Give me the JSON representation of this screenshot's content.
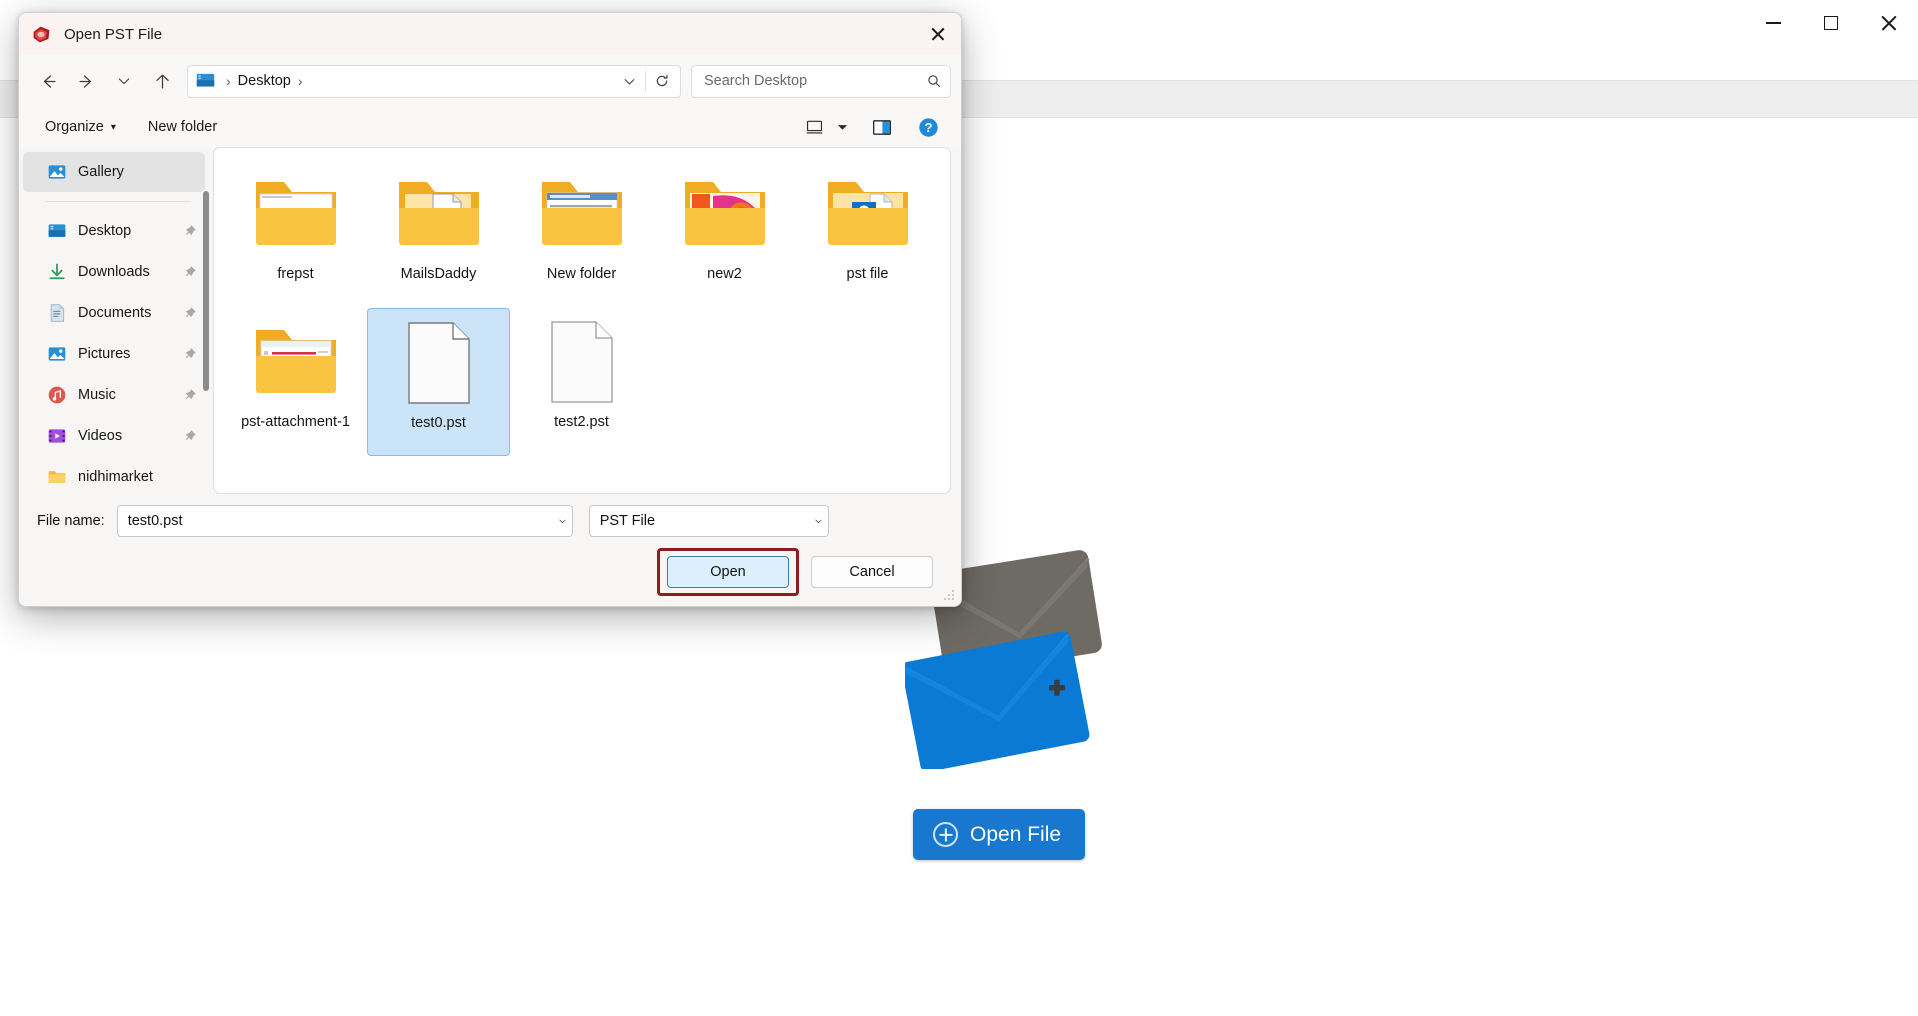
{
  "background_app": {
    "window_controls": [
      {
        "name": "minimize",
        "glyph": "minimize-icon"
      },
      {
        "name": "maximize",
        "glyph": "maximize-icon"
      },
      {
        "name": "close",
        "glyph": "close-icon"
      }
    ],
    "open_file_button": "Open File",
    "open_file_icon": "plus-circle-icon",
    "envelope_gray_color": "#6e6a64",
    "envelope_blue_color": "#0b7ad4",
    "accent_color": "#1878d0"
  },
  "dialog": {
    "title": "Open PST File",
    "app_icon": "pst-file-icon",
    "close_icon": "close-icon",
    "nav": {
      "back_icon": "arrow-left-icon",
      "forward_icon": "arrow-right-icon",
      "recent_icon": "chevron-down-icon",
      "up_icon": "arrow-up-icon",
      "breadcrumb_icon": "desktop-icon",
      "breadcrumb": [
        "Desktop"
      ],
      "breadcrumb_separator": "›",
      "address_dropdown_icon": "chevron-down-icon",
      "refresh_icon": "refresh-icon"
    },
    "search": {
      "placeholder": "Search Desktop",
      "value": "",
      "icon": "search-icon"
    },
    "command_bar": {
      "organize": "Organize",
      "organize_caret": "▾",
      "new_folder": "New folder",
      "view_icon": "view-layout-icon",
      "view_caret": "▾",
      "preview_pane_icon": "preview-pane-icon",
      "help_icon": "help-icon"
    },
    "sidebar": {
      "items": [
        {
          "label": "Gallery",
          "icon": "gallery-icon",
          "pinned": false,
          "selected": true
        },
        {
          "label": "Desktop",
          "icon": "desktop-icon",
          "pinned": true,
          "selected": false
        },
        {
          "label": "Downloads",
          "icon": "downloads-icon",
          "pinned": true,
          "selected": false
        },
        {
          "label": "Documents",
          "icon": "documents-icon",
          "pinned": true,
          "selected": false
        },
        {
          "label": "Pictures",
          "icon": "pictures-icon",
          "pinned": true,
          "selected": false
        },
        {
          "label": "Music",
          "icon": "music-icon",
          "pinned": true,
          "selected": false
        },
        {
          "label": "Videos",
          "icon": "videos-icon",
          "pinned": true,
          "selected": false
        },
        {
          "label": "nidhimarket",
          "icon": "folder-icon",
          "pinned": false,
          "selected": false
        }
      ]
    },
    "files": [
      {
        "name": "frepst",
        "type": "folder",
        "thumb": "document-preview",
        "selected": false
      },
      {
        "name": "MailsDaddy",
        "type": "folder",
        "thumb": "page-preview",
        "selected": false
      },
      {
        "name": "New folder",
        "type": "folder",
        "thumb": "text-preview",
        "selected": false
      },
      {
        "name": "new2",
        "type": "folder",
        "thumb": "image-preview",
        "selected": false
      },
      {
        "name": "pst file",
        "type": "folder",
        "thumb": "outlook-preview",
        "selected": false
      },
      {
        "name": "pst-attachment-1",
        "type": "folder",
        "thumb": "webpage-preview",
        "selected": false
      },
      {
        "name": "test0.pst",
        "type": "file",
        "thumb": "blank-document",
        "selected": true
      },
      {
        "name": "test2.pst",
        "type": "file",
        "thumb": "blank-document",
        "selected": false
      }
    ],
    "filename": {
      "label": "File name:",
      "value": "test0.pst",
      "dropdown_icon": "chevron-down-icon"
    },
    "filetype": {
      "value": "PST File",
      "dropdown_icon": "chevron-down-icon"
    },
    "buttons": {
      "open": "Open",
      "cancel": "Cancel",
      "open_highlight_color": "#8d1d1d"
    }
  }
}
